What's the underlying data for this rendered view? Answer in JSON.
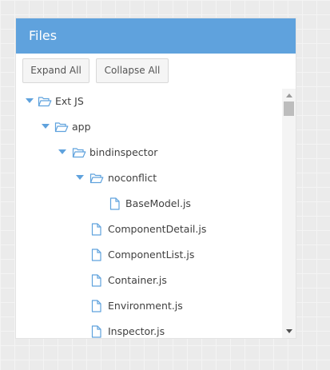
{
  "panel": {
    "title": "Files",
    "header_color": "#5fa2dd"
  },
  "toolbar": {
    "expand_all_label": "Expand All",
    "collapse_all_label": "Collapse All"
  },
  "tree": {
    "nodes": [
      {
        "label": "Ext JS",
        "type": "folder",
        "expanded": true,
        "depth": 0,
        "icon": "folder-open-icon"
      },
      {
        "label": "app",
        "type": "folder",
        "expanded": true,
        "depth": 1,
        "icon": "folder-open-icon"
      },
      {
        "label": "bindinspector",
        "type": "folder",
        "expanded": true,
        "depth": 2,
        "icon": "folder-open-icon"
      },
      {
        "label": "noconflict",
        "type": "folder",
        "expanded": true,
        "depth": 3,
        "icon": "folder-open-icon"
      },
      {
        "label": "BaseModel.js",
        "type": "file",
        "depth": 4,
        "icon": "file-icon"
      },
      {
        "label": "ComponentDetail.js",
        "type": "file",
        "depth": 3,
        "icon": "file-icon"
      },
      {
        "label": "ComponentList.js",
        "type": "file",
        "depth": 3,
        "icon": "file-icon"
      },
      {
        "label": "Container.js",
        "type": "file",
        "depth": 3,
        "icon": "file-icon"
      },
      {
        "label": "Environment.js",
        "type": "file",
        "depth": 3,
        "icon": "file-icon"
      },
      {
        "label": "Inspector.js",
        "type": "file",
        "depth": 3,
        "icon": "file-icon"
      }
    ]
  },
  "colors": {
    "accent": "#5fa2dd",
    "text": "#404040"
  }
}
